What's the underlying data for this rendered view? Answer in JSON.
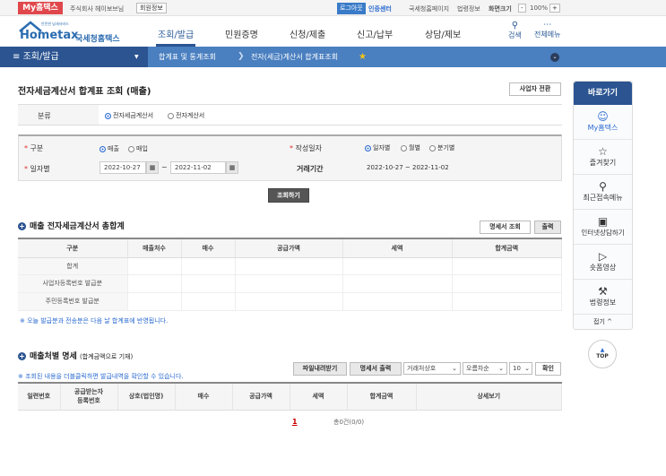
{
  "topbar": {
    "my_hometax": "My홈택스",
    "user": "주식회사 헤이보브님",
    "member_info": "회원정보",
    "logout": "로그아웃",
    "cert_center": "인증센터",
    "links": [
      "국세청홈페이지",
      "법령정보"
    ],
    "zoom_label": "화면크기",
    "zoom_minus": "-",
    "zoom_value": "100%",
    "zoom_plus": "+"
  },
  "logo": {
    "brand": "Hometax",
    "sub": "국세청홈택스",
    "tagline": "안전한 납세서비스"
  },
  "nav": {
    "items": [
      "조회/발급",
      "민원증명",
      "신청/제출",
      "신고/납부",
      "상담/제보"
    ],
    "active": 0,
    "search": "검색",
    "all_menu": "전체메뉴"
  },
  "breadcrumb": {
    "menu": "조회/발급",
    "level1": "합계표 및 통계조회",
    "level2": "전자(세금)계산서 합계표조회"
  },
  "page": {
    "title": "전자세금계산서 합계표 조회 (매출)",
    "switch_button": "사업자 전환"
  },
  "classification": {
    "label": "분류",
    "options": [
      "전자세금계산서",
      "전자계산서"
    ],
    "selected": 0
  },
  "search": {
    "type_label": "구분",
    "type_options": [
      "매출",
      "매입"
    ],
    "type_selected": 0,
    "date_type_label": "작성일자",
    "date_type_options": [
      "일자별",
      "월별",
      "분기별"
    ],
    "date_type_selected": 0,
    "date_label": "일자별",
    "start_date": "2022-10-27",
    "tilde": "~",
    "end_date": "2022-11-02",
    "period_label": "거래기간",
    "period_value": "2022-10-27 ~ 2022-11-02",
    "submit": "조회하기"
  },
  "summary": {
    "title": "매출 전자세금계산서 총합계",
    "detail_button": "명세서 조회",
    "print_button": "출력",
    "columns": [
      "구분",
      "매출처수",
      "매수",
      "공급가액",
      "세액",
      "합계금액"
    ],
    "rows": [
      "합계",
      "사업자등록번호 발급분",
      "주민등록번호 발급분"
    ],
    "note": "※ 오늘 발급분과 전송분은 다음 날 합계표에 반영됩니다."
  },
  "detail": {
    "title": "매출처별 명세",
    "subtitle": "(합계금액으로 기재)",
    "note": "※ 조회된 내용을 더블클릭하면 발급내역을 확인할 수 있습니다.",
    "download": "파일내려받기",
    "print": "명세서 출력",
    "sort_field": "거래처상호",
    "sort_order": "오름차순",
    "page_size": "10",
    "confirm": "확인",
    "columns": [
      "일련번호",
      "공급받는자\n등록번호",
      "상호(법인명)",
      "매수",
      "공급가액",
      "세액",
      "합계금액",
      "상세보기"
    ],
    "page": "1",
    "total": "총0건(0/0)"
  },
  "sidebar": {
    "title": "바로가기",
    "items": [
      "My홈택스",
      "즐겨찾기",
      "최근접속메뉴",
      "인터넷상담하기",
      "숏폼영상",
      "법령정보"
    ],
    "collapse": "접기 ^",
    "top": "TOP"
  }
}
